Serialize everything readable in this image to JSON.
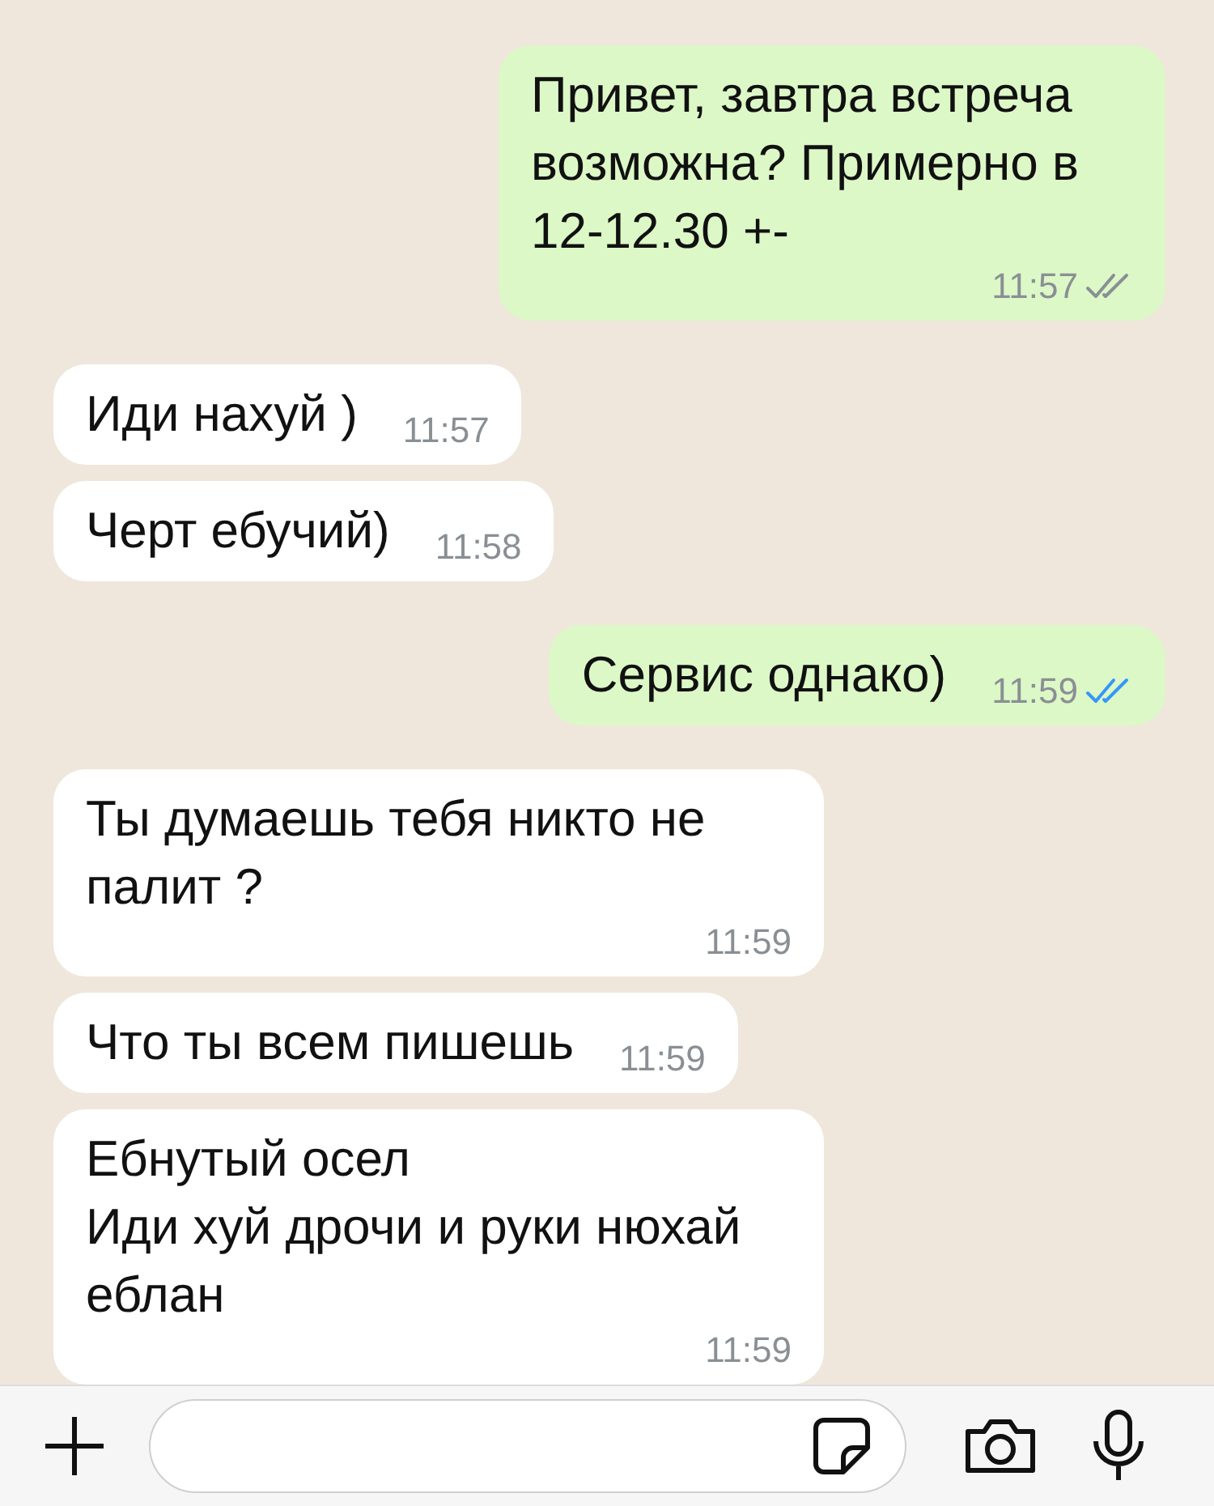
{
  "messages": [
    {
      "kind": "outgoing",
      "text": "Привет, завтра встреча возможна? Примерно в 12-12.30 +-",
      "time": "11:57",
      "read": false
    },
    {
      "kind": "incoming",
      "text": "Иди нахуй )",
      "time": "11:57"
    },
    {
      "kind": "incoming",
      "text": "Черт ебучий)",
      "time": "11:58"
    },
    {
      "kind": "outgoing",
      "text": "Сервис однако)",
      "time": "11:59",
      "read": true
    },
    {
      "kind": "incoming",
      "text": "Ты думаешь тебя никто не палит ?",
      "time": "11:59"
    },
    {
      "kind": "incoming",
      "text": "Что ты всем пишешь",
      "time": "11:59"
    },
    {
      "kind": "incoming",
      "text": "Ебнутый осел\nИди хуй дрочи и руки нюхай еблан",
      "time": "11:59"
    }
  ]
}
